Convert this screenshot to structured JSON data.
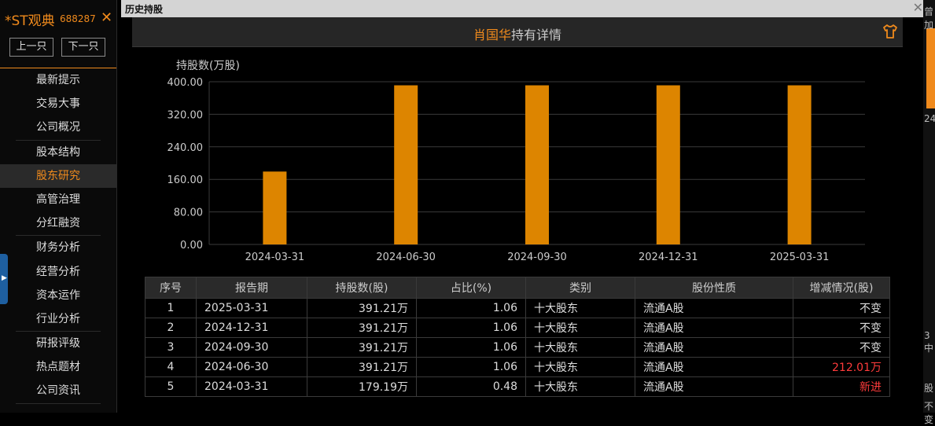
{
  "sidebar": {
    "stock_name": "*ST观典",
    "stock_code": "688287",
    "close_symbol": "✕",
    "prev_label": "上一只",
    "next_label": "下一只",
    "items": [
      {
        "label": "最新提示"
      },
      {
        "label": "交易大事"
      },
      {
        "label": "公司概况"
      },
      {
        "label": "股本结构"
      },
      {
        "label": "股东研究"
      },
      {
        "label": "高管治理"
      },
      {
        "label": "分红融资"
      },
      {
        "label": "财务分析"
      },
      {
        "label": "经营分析"
      },
      {
        "label": "资本运作"
      },
      {
        "label": "行业分析"
      },
      {
        "label": "研报评级"
      },
      {
        "label": "热点题材"
      },
      {
        "label": "公司资讯"
      }
    ],
    "active_item": "股东研究",
    "colors": {
      "accent": "#f08a1c",
      "active_bg": "#2a2a2a"
    }
  },
  "window": {
    "title": "历史持股",
    "close_symbol": "✕"
  },
  "detail": {
    "holder_name": "肖国华",
    "title_suffix": "持有详情",
    "icon": "shirt-icon"
  },
  "chart_data": {
    "type": "bar",
    "ylabel": "持股数(万股)",
    "categories": [
      "2024-03-31",
      "2024-06-30",
      "2024-09-30",
      "2024-12-31",
      "2025-03-31"
    ],
    "values": [
      179.19,
      391.21,
      391.21,
      391.21,
      391.21
    ],
    "ylim": [
      0,
      400
    ],
    "yticks": [
      "0.00",
      "80.00",
      "160.00",
      "240.00",
      "320.00",
      "400.00"
    ],
    "grid": true,
    "bar_color": "#dd8500"
  },
  "table": {
    "headers": [
      "序号",
      "报告期",
      "持股数(股)",
      "占比(%)",
      "类别",
      "股份性质",
      "增减情况(股)"
    ],
    "rows": [
      [
        "1",
        "2025-03-31",
        "391.21万",
        "1.06",
        "十大股东",
        "流通A股",
        "不变"
      ],
      [
        "2",
        "2024-12-31",
        "391.21万",
        "1.06",
        "十大股东",
        "流通A股",
        "不变"
      ],
      [
        "3",
        "2024-09-30",
        "391.21万",
        "1.06",
        "十大股东",
        "流通A股",
        "不变"
      ],
      [
        "4",
        "2024-06-30",
        "391.21万",
        "1.06",
        "十大股东",
        "流通A股",
        "212.01万"
      ],
      [
        "5",
        "2024-03-31",
        "179.19万",
        "0.48",
        "十大股东",
        "流通A股",
        "新进"
      ]
    ],
    "highlight_color": "#ff3b3b"
  },
  "right_strip": {
    "texts": [
      "曾加",
      "24",
      "3中",
      "股",
      "不变"
    ]
  }
}
